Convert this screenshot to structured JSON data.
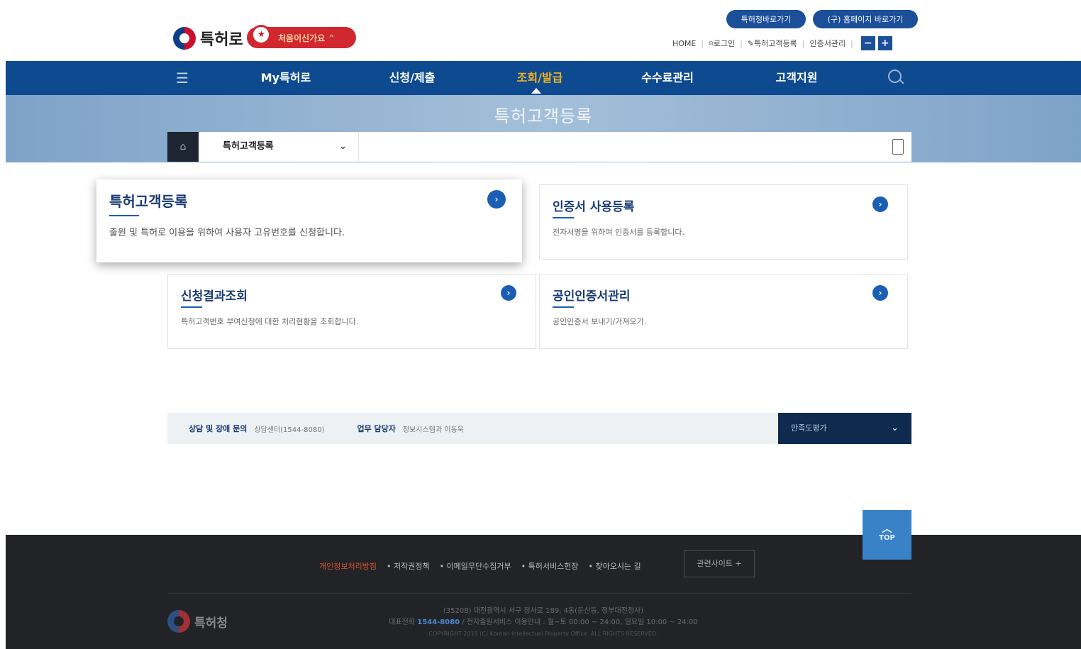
{
  "header": {
    "logo_text": "특허로",
    "first_visit_badge": "처음이신가요 ⌃",
    "pill_kipo": "특허청바로가기",
    "pill_old_home": "(구) 홈페이지 바로가기",
    "util": {
      "home": "HOME",
      "login": "로그인",
      "register": "특허고객등록",
      "cert_manage": "인증서관리",
      "zoom_out": "−",
      "zoom_in": "+"
    }
  },
  "gnb": {
    "items": [
      "My특허로",
      "신청/제출",
      "조회/발급",
      "수수료관리",
      "고객지원"
    ],
    "active_index": 2
  },
  "band": {
    "title": "특허고객등록",
    "breadcrumb_selected": "특허고객등록",
    "print_label": "인쇄"
  },
  "cards": [
    {
      "title": "특허고객등록",
      "desc": "출원 및 특허로 이용을 위하여 사용자 고유번호를 신청합니다."
    },
    {
      "title": "인증서 사용등록",
      "desc": "전자서명을 위하여 인증서를 등록합니다."
    },
    {
      "title": "신청결과조회",
      "desc": "특허고객번호 부여신청에 대한 처리현황을 조회합니다."
    },
    {
      "title": "공인인증서관리",
      "desc": "공인인증서 보내기/가져오기."
    }
  ],
  "contact": {
    "label_support": "상담 및 장애 문의",
    "value_support": "상담센터(1544-8080)",
    "label_manager": "업무 담당자",
    "value_manager": "정보시스템과 이동욱",
    "satisfaction": "만족도평가"
  },
  "top_button": "TOP",
  "footer": {
    "links": [
      "개인정보처리방침",
      "• 저작권정책",
      "• 이메일무단수집거부",
      "• 특허서비스헌장",
      "• 찾아오시는 길"
    ],
    "related_sites": "관련사이트 +",
    "logo_text": "특허청",
    "address": "(35208) 대전광역시 서구 청사로 189, 4동(둔산동, 정부대전청사)",
    "phone_prefix": "대표전화",
    "phone": "1544-8080",
    "phone_suffix": "/ 전자출원서비스 이용안내 : 월~토 00:00 ~ 24:00, 일요일 10:00 ~ 24:00",
    "copyright": "COPYRIGHT 2019 (C) Korean Intellectual Property Office. ALL RIGHTS RESERVED."
  },
  "colors": {
    "gnb_bg": "#0d4a8f",
    "active_menu": "#f4b223",
    "accent_blue": "#1a5fb4",
    "footer_bg": "#222326"
  }
}
